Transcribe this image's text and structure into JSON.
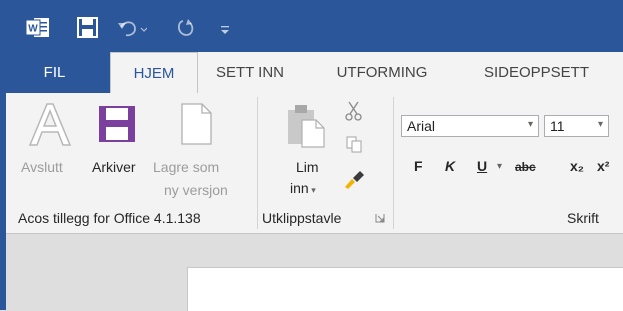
{
  "colors": {
    "brand": "#2b579a",
    "ribbon": "#f3f3f3",
    "accent_purple": "#7b3f9e"
  },
  "qat": {
    "icons": [
      "word-icon",
      "save-icon",
      "undo-icon",
      "redo-icon",
      "customize-qat-icon"
    ]
  },
  "tabs": [
    {
      "label": "FIL"
    },
    {
      "label": "HJEM"
    },
    {
      "label": "SETT INN"
    },
    {
      "label": "UTFORMING"
    },
    {
      "label": "SIDEOPPSETT"
    }
  ],
  "groups": {
    "acos": {
      "label": "Acos tillegg for Office 4.1.138",
      "buttons": [
        {
          "label": "Avslutt",
          "icon": "letter-a-icon",
          "enabled": false
        },
        {
          "label": "Arkiver",
          "icon": "save-icon",
          "enabled": true
        },
        {
          "label_line1": "Lagre som",
          "label_line2": "ny versjon",
          "icon": "blank-page-icon",
          "enabled": false
        }
      ]
    },
    "clipboard": {
      "label": "Utklippstavle",
      "paste_line1": "Lim",
      "paste_line2": "inn",
      "small_icons": [
        "cut-icon",
        "copy-icon",
        "format-painter-icon"
      ],
      "launcher_icon": "dialog-launcher-icon"
    },
    "font": {
      "label": "Skrift",
      "font_name": "Arial",
      "font_size": "11",
      "format_buttons": [
        "F",
        "K",
        "U",
        "abc",
        "x₂",
        "x²"
      ]
    }
  }
}
